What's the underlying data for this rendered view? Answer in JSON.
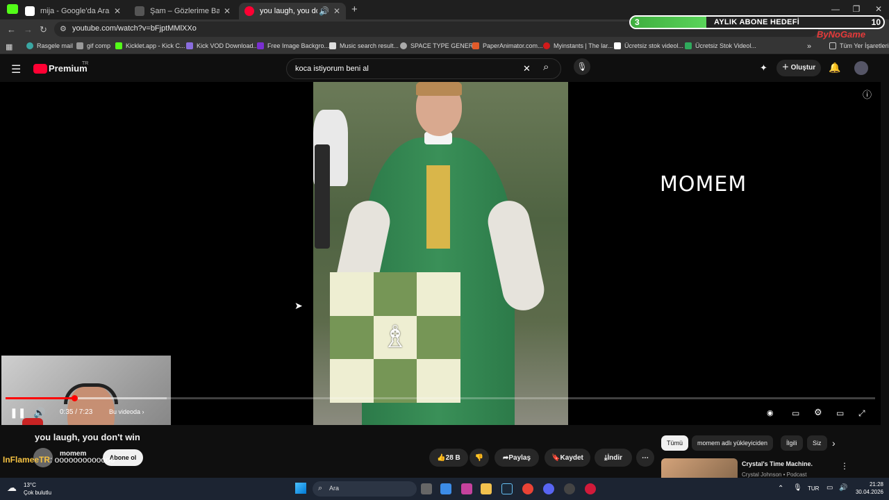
{
  "browser": {
    "tabs": [
      {
        "title": "mija - Google'da Ara",
        "fav_color": "#4285f4"
      },
      {
        "title": "Şam – Gözlerime Bak Lyrics | Ge",
        "fav_color": "#444444"
      },
      {
        "title": "you laugh, you don't win - YouTube",
        "fav_color": "#ff0033",
        "active": true
      }
    ],
    "url": "youtube.com/watch?v=bFjptMMlXXo",
    "bookmarks": [
      {
        "label": "Rasgele mail",
        "color": "#3aa7a3"
      },
      {
        "label": "gif comp",
        "color": "#999999"
      },
      {
        "label": "Kicklet.app - Kick C...",
        "color": "#53fc18"
      },
      {
        "label": "Kick VOD Download...",
        "color": "#8a6dde"
      },
      {
        "label": "Free Image Backgro...",
        "color": "#7a2fd1"
      },
      {
        "label": "Music search result...",
        "color": "#dddddd"
      },
      {
        "label": "SPACE TYPE GENER...",
        "color": "#aaaaaa"
      },
      {
        "label": "PaperAnimator.com...",
        "color": "#e25b2a"
      },
      {
        "label": "Myinstants | The lar...",
        "color": "#d11a1a"
      },
      {
        "label": "Ücretsiz stok videol...",
        "color": "#ffffff"
      },
      {
        "label": "Ücretsiz Stok Videol...",
        "color": "#2faa5c"
      }
    ],
    "bookmarks_all": "Tüm Yer İşaretleri"
  },
  "overlay": {
    "goal_current": "3",
    "goal_label": "AYLIK ABONE HEDEFİ",
    "goal_max": "10",
    "goal_progress": 0.3,
    "brand": "ByNoGame"
  },
  "youtube": {
    "logo": "Premium",
    "logo_sup": "TR",
    "search_value": "koca istiyorum beni al",
    "create_label": "Oluştur"
  },
  "video": {
    "watermark": "MOMEM",
    "time_current": "0:35",
    "time_total": "7:23",
    "time_text": "0:35 / 7:23",
    "chapter": "Bu videoda",
    "played_fraction": 0.079,
    "buffered_fraction": 0.185,
    "chess_piece": "♗"
  },
  "details": {
    "title": "you laugh, you don't win",
    "channel": "momem",
    "subscribe": "Abone ol",
    "likes": "28 B",
    "share": "Paylaş",
    "save": "Kaydet",
    "download": "İndir",
    "chat_user": "InFlameeTR",
    "chat_msg": ": ooooooooooooo"
  },
  "sidebar": {
    "chips": [
      "Tümü",
      "momem adlı yükleyiciden",
      "İlgili",
      "Siz"
    ],
    "rec_title": "Crystal's Time Machine.",
    "rec_sub": "Crystal Johnson • Podcast"
  },
  "taskbar": {
    "temp": "13°C",
    "weather": "Çok bulutlu",
    "search": "Ara",
    "lang": "TUR",
    "time": "21:28",
    "date": "30.04.2026"
  }
}
